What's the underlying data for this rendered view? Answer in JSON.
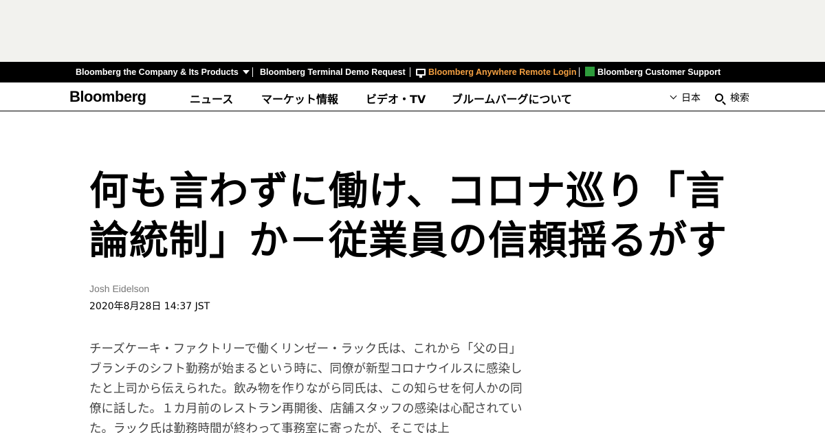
{
  "corp_bar": {
    "company_label": "Bloomberg the Company & Its Products",
    "terminal_demo": "Bloomberg Terminal Demo Request",
    "anywhere_login": "Bloomberg Anywhere Remote Login",
    "customer_support": "Bloomberg Customer Support",
    "accent_color": "#f39f41"
  },
  "nav": {
    "logo": "Bloomberg",
    "links": [
      "ニュース",
      "マーケット情報",
      "ビデオ・TV",
      "ブルームバーグについて"
    ],
    "region": "日本",
    "search": "検索"
  },
  "article": {
    "headline_line1": "何も言わずに働け、コロナ巡り「言",
    "headline_line2": "論統制」か－従業員の信頼揺るがす",
    "author": "Josh Eidelson",
    "date": "2020年8月28日 14:37 JST",
    "body": "チーズケーキ・ファクトリーで働くリンゼー・ラック氏は、これから「父の日」ブランチのシフト勤務が始まるという時に、同僚が新型コロナウイルスに感染したと上司から伝えられた。飲み物を作りながら同氏は、この知らせを何人かの同僚に話した。１カ月前のレストラン再開後、店舗スタッフの感染は心配されていた。ラック氏は勤務時間が終わって事務室に寄ったが、そこでは上"
  }
}
